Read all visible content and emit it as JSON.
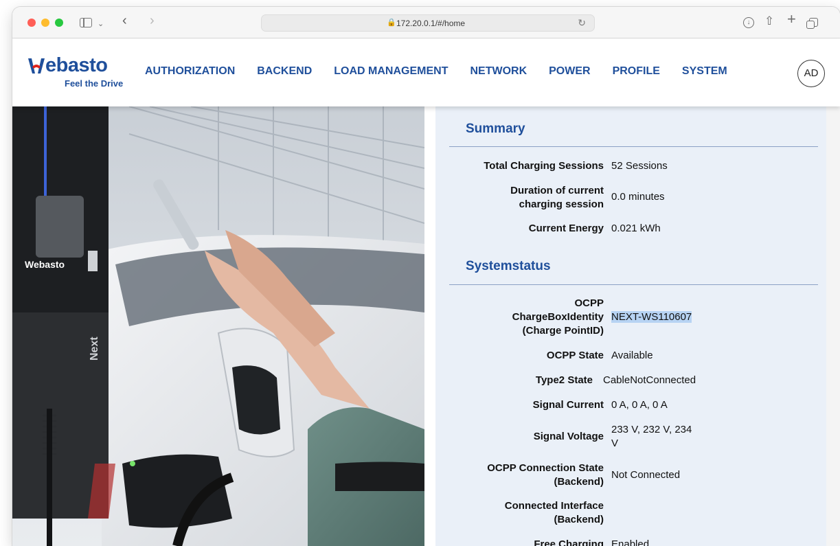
{
  "browser": {
    "url": "172.20.0.1/#/home",
    "lock_glyph": "🔒",
    "reload_glyph": "↻",
    "back_glyph": "‹",
    "forward_glyph": "›",
    "chevron_glyph": "⌄",
    "download_glyph": "↓",
    "share_glyph": "⇧",
    "new_tab_glyph": "+"
  },
  "brand": {
    "name": "Webasto",
    "word": "ebasto",
    "tagline": "Feel the Drive",
    "color": "#1f4f9b",
    "accent": "#e2231a"
  },
  "nav": {
    "items": [
      {
        "label": "AUTHORIZATION"
      },
      {
        "label": "BACKEND"
      },
      {
        "label": "LOAD MANAGEMENT"
      },
      {
        "label": "NETWORK"
      },
      {
        "label": "POWER"
      },
      {
        "label": "PROFILE"
      },
      {
        "label": "SYSTEM"
      }
    ],
    "user_initials": "AD"
  },
  "hero": {
    "charger_brand": "Webasto",
    "charger_model": "Next"
  },
  "summary": {
    "title": "Summary",
    "rows": [
      {
        "label": "Total Charging Sessions",
        "value": "52 Sessions"
      },
      {
        "label": "Duration of current charging session",
        "value": "0.0 minutes"
      },
      {
        "label": "Current Energy",
        "value": "0.021 kWh"
      }
    ]
  },
  "systemstatus": {
    "title": "Systemstatus",
    "rows": [
      {
        "label": "OCPP ChargeBoxIdentity (Charge PointID)",
        "value": "NEXT-WS110607"
      },
      {
        "label": "OCPP State",
        "value": "Available"
      },
      {
        "label": "Type2 State",
        "value": "CableNotConnected"
      },
      {
        "label": "Signal Current",
        "value": "0 A, 0 A, 0 A"
      },
      {
        "label": "Signal Voltage",
        "value": "233 V, 232 V, 234 V"
      },
      {
        "label": "OCPP Connection State (Backend)",
        "value": "Not Connected"
      },
      {
        "label": "Connected Interface (Backend)",
        "value": ""
      },
      {
        "label": "Free Charging",
        "value": "Enabled"
      }
    ]
  }
}
